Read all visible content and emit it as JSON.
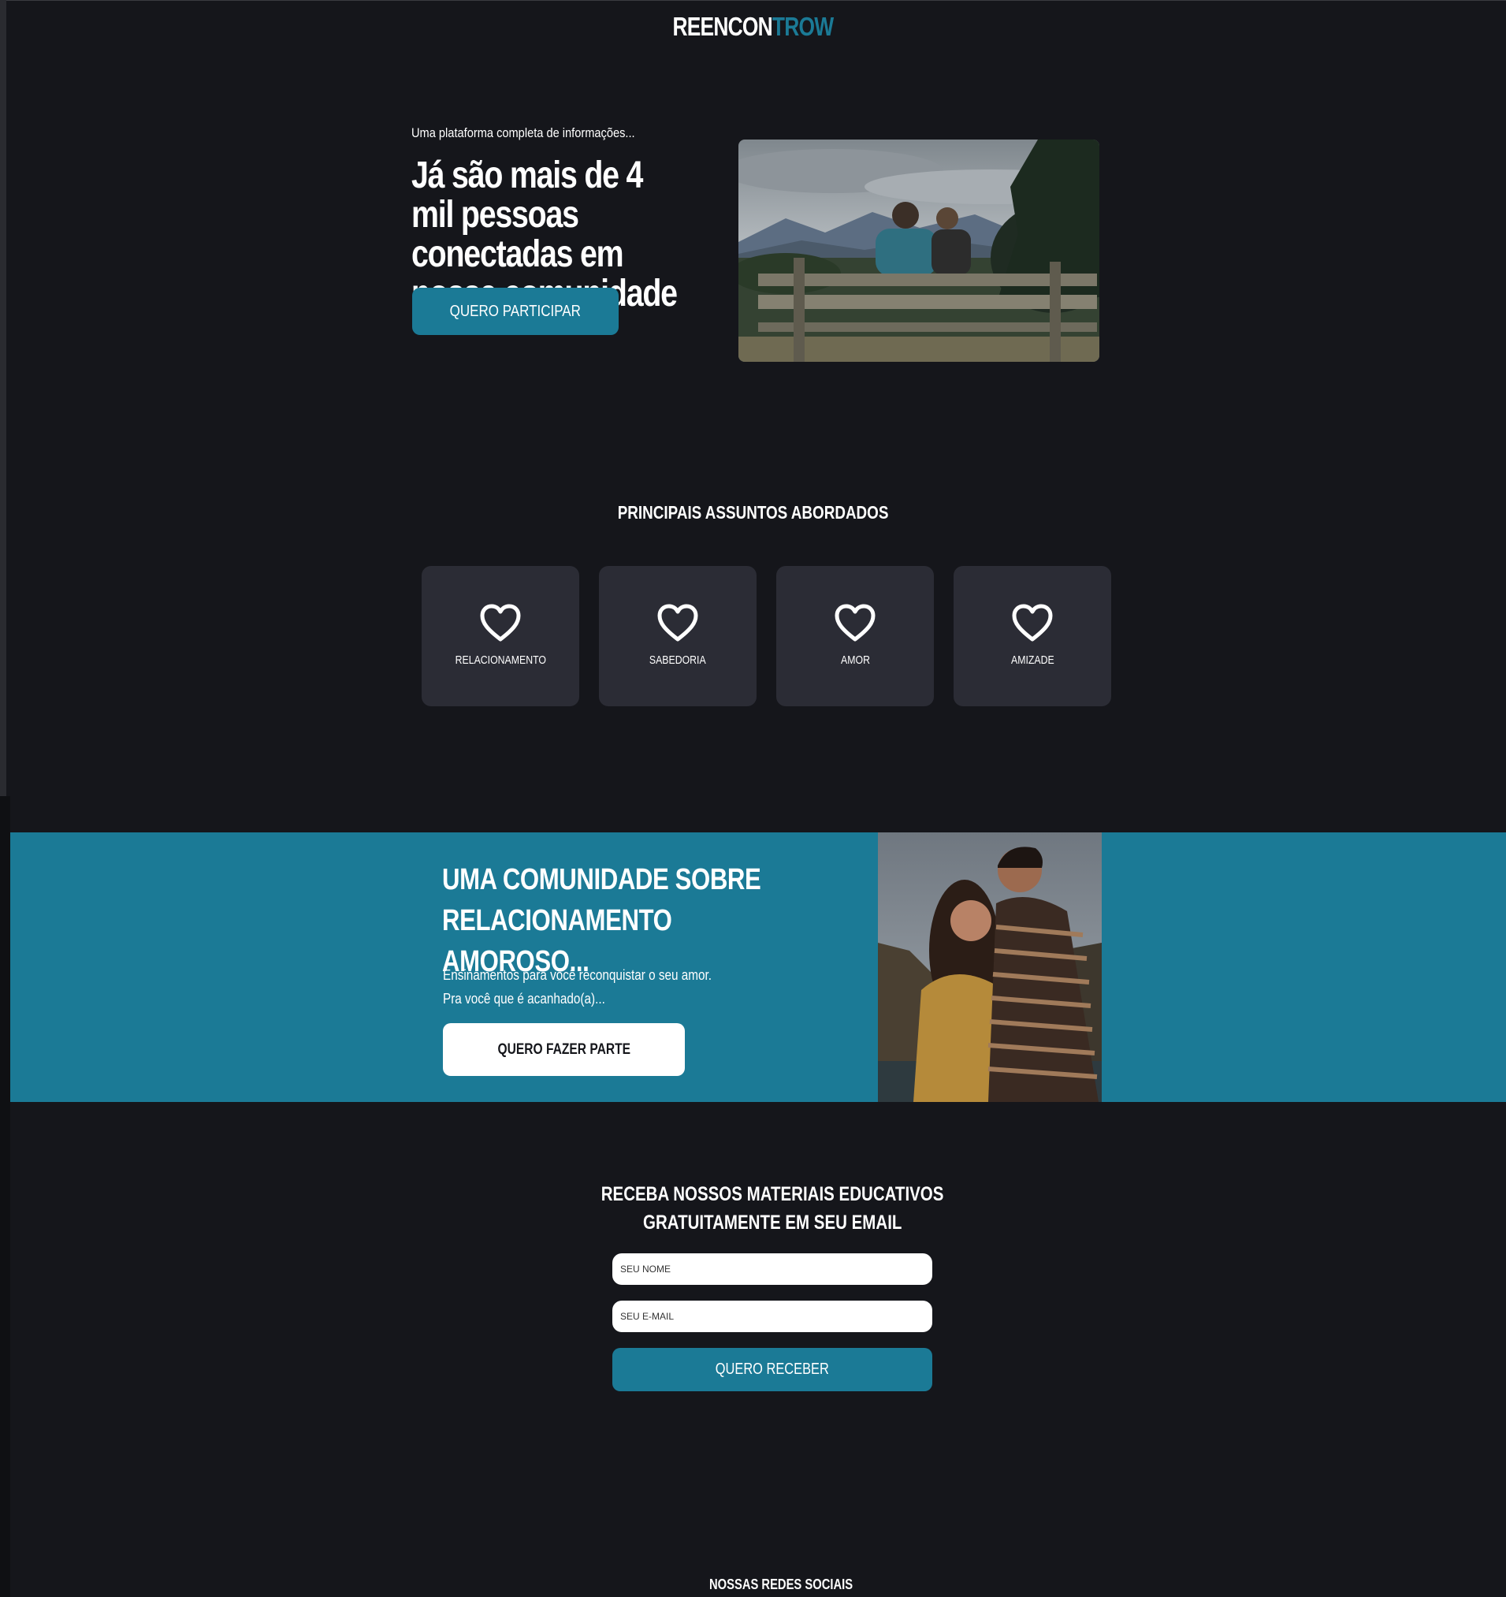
{
  "header": {
    "logo_part1": "REENCON",
    "logo_part2": "TROW",
    "accent_color": "#1b7a96"
  },
  "hero": {
    "subtitle": "Uma plataforma completa de informações...",
    "title": "Já são mais de 4 mil pessoas conectadas em nossa comunidade",
    "cta_label": "QUERO PARTICIPAR"
  },
  "topics": {
    "title": "PRINCIPAIS ASSUNTOS ABORDADOS",
    "items": [
      {
        "label": "RELACIONAMENTO",
        "icon": "heart-icon"
      },
      {
        "label": "SABEDORIA",
        "icon": "heart-icon"
      },
      {
        "label": "AMOR",
        "icon": "heart-icon"
      },
      {
        "label": "AMIZADE",
        "icon": "heart-icon"
      }
    ]
  },
  "community": {
    "title": "UMA COMUNIDADE SOBRE RELACIONAMENTO AMOROSO...",
    "text_line1": "Ensinamentos para você reconquistar o seu amor.",
    "text_line2": "Pra você que é acanhado(a)...",
    "cta_label": "QUERO FAZER PARTE"
  },
  "newsletter": {
    "title_line1": "RECEBA NOSSOS MATERIAIS EDUCATIVOS",
    "title_line2": "GRATUITAMENTE EM SEU EMAIL",
    "name_placeholder": "SEU NOME",
    "email_placeholder": "SEU E-MAIL",
    "submit_label": "QUERO RECEBER"
  },
  "social": {
    "title": "NOSSAS REDES SOCIAIS"
  }
}
